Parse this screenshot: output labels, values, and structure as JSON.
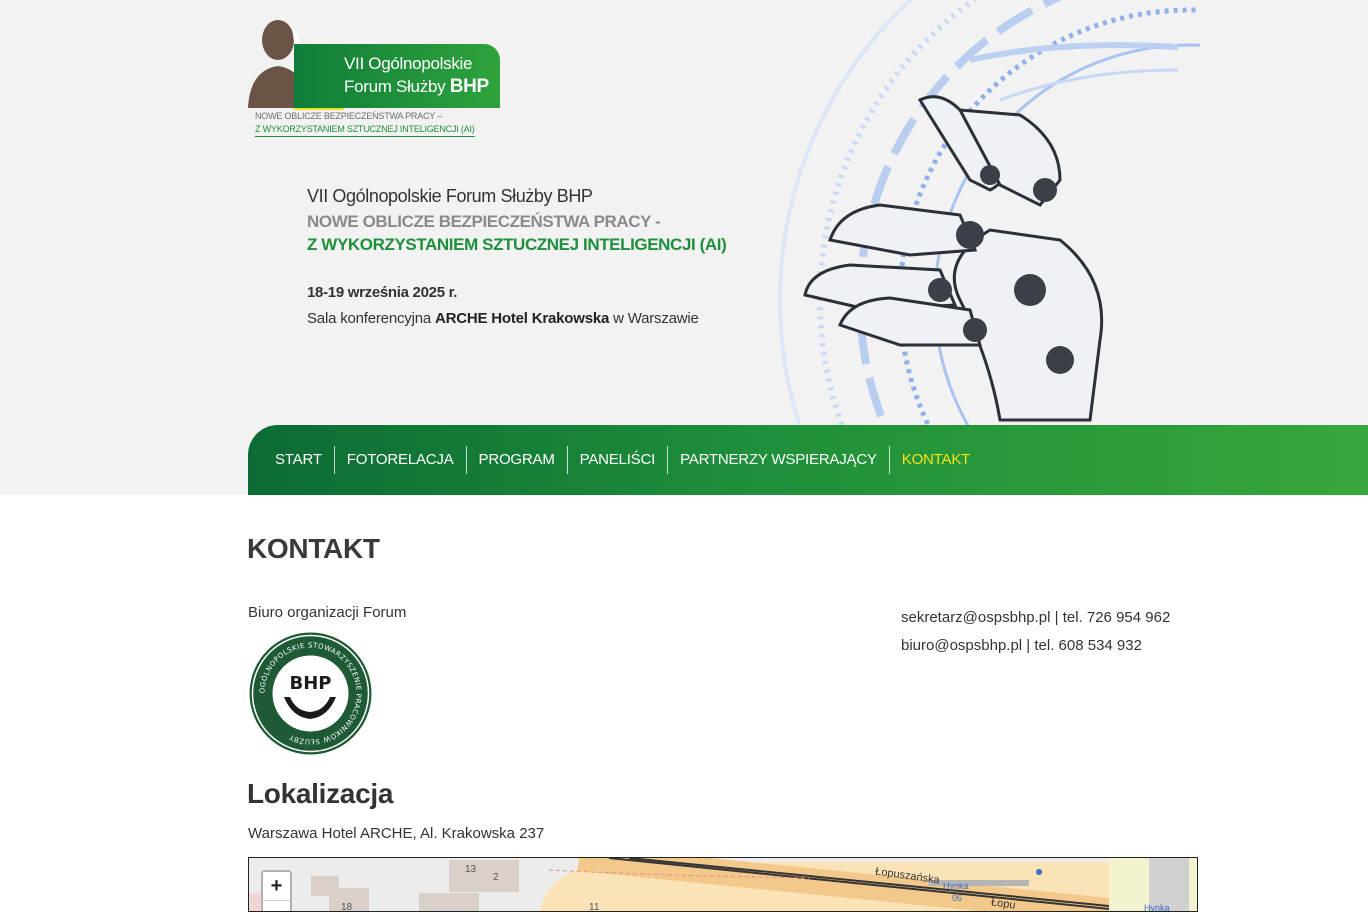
{
  "logo": {
    "line1": "VII Ogólnopolskie",
    "line2": "Forum Służby",
    "line2_bold": "BHP",
    "sub1": "NOWE OBLICZE BEZPIECZEŃSTWA PRACY –",
    "sub2": "Z WYKORZYSTANIEM SZTUCZNEJ INTELIGENCJI (AI)"
  },
  "hero": {
    "title": "VII Ogólnopolskie Forum Służby BHP",
    "subtitle1": "NOWE OBLICZE BEZPIECZEŃSTWA PRACY -",
    "subtitle2": "Z WYKORZYSTANIEM SZTUCZNEJ INTELIGENCJI (AI)",
    "date": "18-19 września 2025 r.",
    "venue_prefix": "Sala konferencyjna ",
    "venue_bold": "ARCHE Hotel Krakowska",
    "venue_suffix": " w Warszawie"
  },
  "nav": {
    "items": [
      {
        "label": "START",
        "active": false
      },
      {
        "label": "FOTORELACJA",
        "active": false
      },
      {
        "label": "PROGRAM",
        "active": false
      },
      {
        "label": "PANELIŚCI",
        "active": false
      },
      {
        "label": "PARTNERZY WSPIERAJĄCY",
        "active": false
      },
      {
        "label": "KONTAKT",
        "active": true
      }
    ]
  },
  "content": {
    "title": "KONTAKT",
    "office_label": "Biuro organizacji Forum",
    "seal": {
      "letters": "BHP",
      "ring_text": "OGÓLNOPOLSKIE STOWARZYSZENIE PRACOWNIKÓW SŁUŻBY"
    },
    "contacts": [
      "sekretarz@ospsbhp.pl | tel. 726 954 962",
      "biuro@ospsbhp.pl | tel. 608 534 932"
    ],
    "location_title": "Lokalizacja",
    "address": "Warszawa Hotel ARCHE, Al. Krakowska 237"
  },
  "map": {
    "zoom_in": "+",
    "zoom_out": "−",
    "labels": [
      "13",
      "2",
      "18",
      "11"
    ],
    "street1": "Łopuszańska",
    "street2": "Łopu",
    "stop1": "Hynka",
    "stop1_code": "06",
    "stop2": "Hynka"
  },
  "colors": {
    "nav_dark": "#0c6b34",
    "nav_light": "#37a63a",
    "active": "#f5e21b",
    "green_text": "#1e8f3a"
  }
}
